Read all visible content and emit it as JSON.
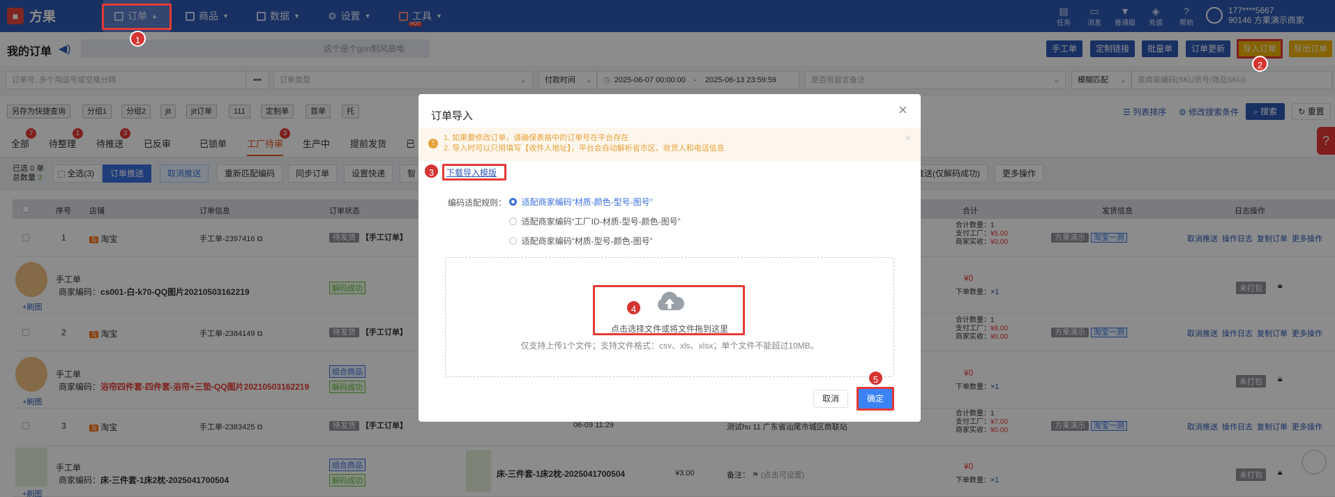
{
  "app": {
    "logo_glyph": "■",
    "name": "方果"
  },
  "nav": [
    {
      "label": "订单",
      "icon": "order-icon",
      "active": true
    },
    {
      "label": "商品",
      "icon": "goods-icon"
    },
    {
      "label": "数据",
      "icon": "data-icon"
    },
    {
      "label": "设置",
      "icon": "gear-icon"
    },
    {
      "label": "工具",
      "icon": "tool-icon",
      "hot": "HOT"
    }
  ],
  "topright": [
    {
      "label": "任务",
      "icon": "task-icon"
    },
    {
      "label": "消息",
      "icon": "message-icon"
    },
    {
      "label": "普通版",
      "icon": "shirt-icon"
    },
    {
      "label": "充值",
      "icon": "recharge-icon"
    },
    {
      "label": "帮助",
      "icon": "help-icon"
    }
  ],
  "user": {
    "phone": "177****5667",
    "store": "90146 方果演示商家"
  },
  "steps": [
    "1",
    "2",
    "3",
    "4",
    "5"
  ],
  "page": {
    "title": "我的订单",
    "notice": "这个是个gon制风扇电",
    "buttons": [
      "手工单",
      "定制链接",
      "批量单",
      "订单更新",
      "导入订单",
      "导出订单"
    ]
  },
  "filters": {
    "order_no": "订单号, 多个用逗号或空格分隔",
    "more": "•••",
    "order_type": "订单类型",
    "pay_time": "付款时间",
    "date_from": "2025-06-07 00:00:00",
    "dash": "-",
    "date_to": "2025-06-13 23:59:59",
    "remark": "是否有留言备注",
    "fuzzy": "模糊匹配",
    "sku": "原商家编码(SKU货号/商品SKU)"
  },
  "chips": [
    "另存为快捷查询",
    "分组1",
    "分组2",
    "jit",
    "jit订单",
    "111",
    "定制单",
    "首单",
    "托"
  ],
  "tools": {
    "list_sort": "列表排序",
    "modify": "修改搜索条件",
    "search": "搜索",
    "reset": "重置"
  },
  "tabs": [
    {
      "label": "全部",
      "badge": "7"
    },
    {
      "label": "待整理",
      "badge": "1"
    },
    {
      "label": "待推送",
      "badge": "3"
    },
    {
      "label": "已反审"
    },
    {
      "label": "已锁单"
    },
    {
      "label": "工厂待审",
      "badge": "3",
      "active": true
    },
    {
      "label": "生产中"
    },
    {
      "label": "提前发货"
    },
    {
      "label": "已"
    }
  ],
  "selection": {
    "selected": "已选 0 单",
    "total_label": "总数量",
    "total": "3"
  },
  "actions": [
    "全选(3)",
    "订单推送",
    "取消推送",
    "重新匹配编码",
    "同步订单",
    "设置快递",
    "智"
  ],
  "actions_right": [
    "推送(仅解码成功)",
    "更多操作"
  ],
  "columns": [
    "序号",
    "店铺",
    "订单信息",
    "订单状态",
    "合计",
    "发货信息",
    "日志操作"
  ],
  "rows": [
    {
      "no": "1",
      "shop": "淘宝",
      "order": "手工单-2397416",
      "status": "待发货",
      "tag": "【手工订单】",
      "count": "合计数量：1",
      "pay": "支付工厂：",
      "pay_val": "¥5.00",
      "real": "商家实收：",
      "real_val": "¥0.00",
      "ship1": "方果演示",
      "ship2": "淘宝一测",
      "ops": [
        "取消推送",
        "操作日志",
        "复制订单",
        "更多操作"
      ],
      "name": "手工单",
      "code_label": "商家编码：",
      "code": "cs001-白-k70-QQ图片20210503162219",
      "decode": "解码成功",
      "price": "¥0",
      "qty_label": "下单数量：",
      "qty": "×1",
      "pack": "未打包",
      "refresh": "+刷图"
    },
    {
      "no": "2",
      "shop": "淘宝",
      "order": "手工单-2384149",
      "status": "待发货",
      "tag": "【手工订单】",
      "count": "合计数量：1",
      "pay": "支付工厂：",
      "pay_val": "¥8.00",
      "real": "商家实收：",
      "real_val": "¥0.00",
      "ship1": "方果演示",
      "ship2": "淘宝一测",
      "ops": [
        "取消推送",
        "操作日志",
        "复制订单",
        "更多操作"
      ],
      "name": "手工单",
      "code_label": "商家编码：",
      "code": "浴帘四件套-四件套-浴帘+三垫-QQ图片20210503162219",
      "combo": "组合商品",
      "decode": "解码成功",
      "price": "¥0",
      "qty_label": "下单数量：",
      "qty": "×1",
      "pack": "未打包",
      "refresh": "+刷图"
    },
    {
      "no": "3",
      "shop": "淘宝",
      "order": "手工单-2383425",
      "status": "待发货",
      "tag": "【手工订单】",
      "time": "06-09 11:29",
      "addr": "测试hu 11 广东省汕尾市城区商联站",
      "count": "合计数量：1",
      "pay": "支付工厂：",
      "pay_val": "¥7.00",
      "real": "商家实收：",
      "real_val": "¥0.00",
      "ship1": "方果演示",
      "ship2": "淘宝一测",
      "ops": [
        "取消推送",
        "操作日志",
        "复制订单",
        "更多操作"
      ],
      "name": "手工单",
      "code_label": "商家编码：",
      "code": "床-三件套-1床2枕-2025041700504",
      "combo": "组合商品",
      "decode": "解码成功",
      "product": "床-三件套-1床2枕-2025041700504",
      "unit_price": "¥3.00",
      "note": "备注：",
      "note_val": "(点击可设置)",
      "price": "¥0",
      "qty_label": "下单数量：",
      "qty": "×1",
      "pack": "未打包",
      "refresh": "+刷图"
    }
  ],
  "modal": {
    "title": "订单导入",
    "close": "×",
    "tip1": "1. 如果要修改订单，请确保表格中的订单号在平台存在",
    "tip2": "2. 导入时可以只用填写【收件人地址】，平台会自动解析省市区、收货人和电话信息",
    "download": "下载导入模版",
    "rule_label": "编码适配规则：",
    "rules": [
      "适配商家编码“材质-颜色-型号-图号”",
      "适配商家编码“工厂ID-材质-型号-颜色-图号”",
      "适配商家编码“材质-型号-颜色-图号”"
    ],
    "upload_text": "点击选择文件或将文件拖到这里",
    "upload_hint": "仅支持上传1个文件；支持文件格式：csv、xls、xlsx；单个文件不能超过10MB。",
    "cancel": "取消",
    "confirm": "确定"
  }
}
